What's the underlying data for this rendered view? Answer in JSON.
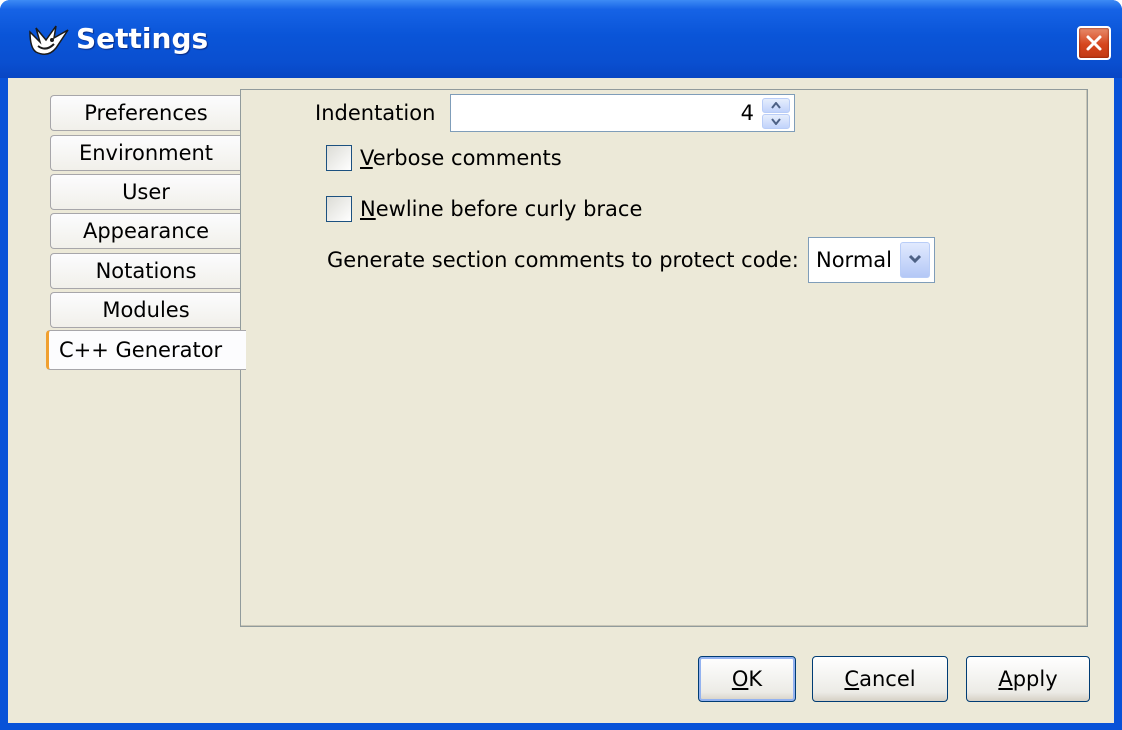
{
  "window": {
    "title": "Settings",
    "app_icon": "bird-logo-icon",
    "close_icon": "close-icon"
  },
  "tabs": [
    {
      "label": "Preferences",
      "selected": false
    },
    {
      "label": "Environment",
      "selected": false
    },
    {
      "label": "User",
      "selected": false
    },
    {
      "label": "Appearance",
      "selected": false
    },
    {
      "label": "Notations",
      "selected": false
    },
    {
      "label": "Modules",
      "selected": false
    },
    {
      "label": "C++ Generator",
      "selected": true
    }
  ],
  "panel": {
    "indentation": {
      "label": "Indentation",
      "value": "4"
    },
    "verbose_comments": {
      "label_rest": "erbose comments",
      "mnemonic": "V",
      "checked": false
    },
    "newline_brace": {
      "label_rest": "ewline before curly brace",
      "mnemonic": "N",
      "checked": false
    },
    "section_comments": {
      "label": "Generate section comments to protect code:",
      "selected": "Normal"
    }
  },
  "buttons": {
    "ok": {
      "mnemonic": "O",
      "rest": "K"
    },
    "cancel": {
      "mnemonic": "C",
      "rest": "ancel"
    },
    "apply": {
      "mnemonic": "A",
      "rest": "pply"
    }
  },
  "colors": {
    "titlebar": "#0a55d8",
    "dialog_bg": "#ece9d8",
    "selected_tab_accent": "#f0a030"
  }
}
